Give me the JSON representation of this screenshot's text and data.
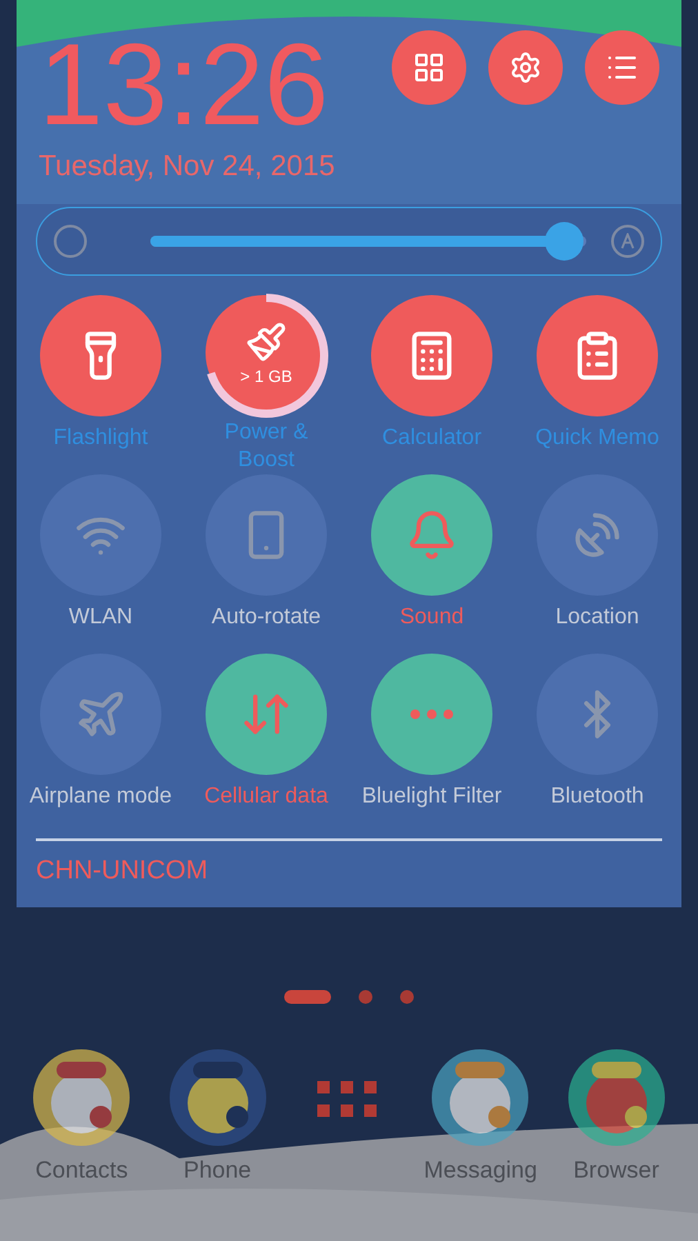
{
  "clock": {
    "time": "13:26",
    "date": "Tuesday, Nov 24, 2015"
  },
  "brightness": {
    "level": 0.95
  },
  "tiles": [
    {
      "kind": "shortcut",
      "label": "Flashlight"
    },
    {
      "kind": "boost",
      "label": "Power & Boost",
      "badge": "> 1 GB"
    },
    {
      "kind": "shortcut",
      "label": "Calculator"
    },
    {
      "kind": "shortcut",
      "label": "Quick Memo"
    },
    {
      "kind": "toggle",
      "label": "WLAN",
      "on": false,
      "highlighted": false
    },
    {
      "kind": "toggle",
      "label": "Auto-rotate",
      "on": false,
      "highlighted": false
    },
    {
      "kind": "toggle",
      "label": "Sound",
      "on": true,
      "highlighted": true
    },
    {
      "kind": "toggle",
      "label": "Location",
      "on": false,
      "highlighted": false
    },
    {
      "kind": "toggle",
      "label": "Airplane mode",
      "on": false,
      "highlighted": false
    },
    {
      "kind": "toggle",
      "label": "Cellular data",
      "on": true,
      "highlighted": true
    },
    {
      "kind": "toggle",
      "label": "Bluelight Filter",
      "on": true,
      "highlighted": false
    },
    {
      "kind": "toggle",
      "label": "Bluetooth",
      "on": false,
      "highlighted": false
    }
  ],
  "carrier": "CHN-UNICOM",
  "pages": [
    {
      "selected": true
    },
    {
      "selected": false
    },
    {
      "selected": false
    }
  ],
  "dock": [
    {
      "label": "Contacts"
    },
    {
      "label": "Phone"
    },
    {
      "label": "Messaging"
    },
    {
      "label": "Browser"
    }
  ]
}
